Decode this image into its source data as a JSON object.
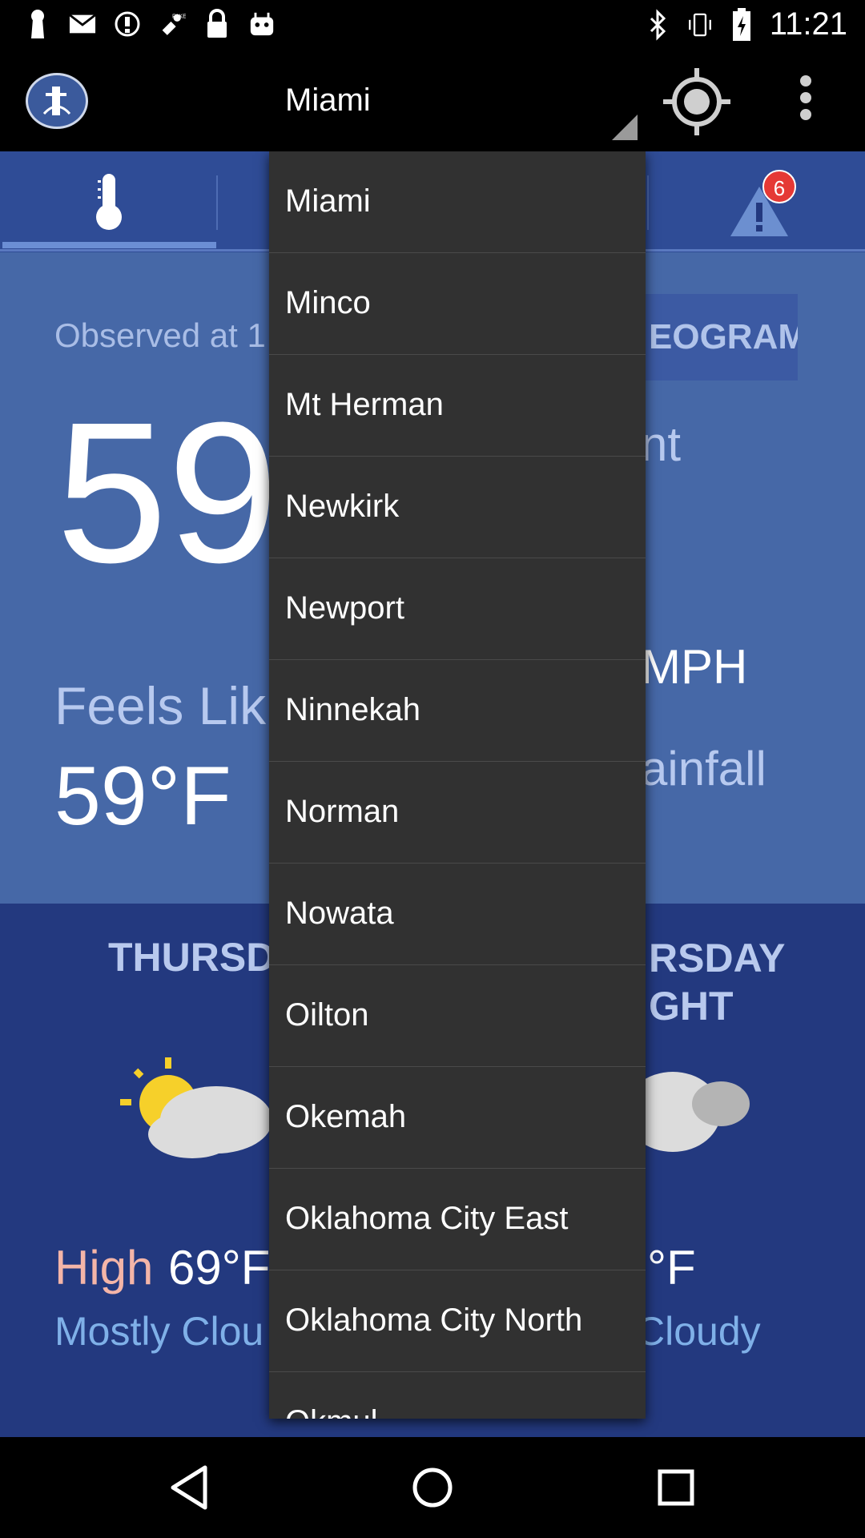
{
  "status_bar": {
    "time": "11:21",
    "left_icons": [
      "keyhole-icon",
      "mail-icon",
      "alert-circle-icon",
      "fake-gps-icon",
      "lock-icon",
      "android-icon"
    ],
    "right_icons": [
      "bluetooth-icon",
      "vibrate-icon",
      "battery-charging-icon"
    ]
  },
  "app_bar": {
    "location_selected": "Miami",
    "actions": [
      "locate-icon",
      "overflow-menu-icon"
    ]
  },
  "tabs": {
    "icons": [
      "thermometer-icon",
      "warning-icon"
    ],
    "alert_count": "6"
  },
  "current": {
    "observed_prefix": "Observed at 1",
    "temperature": "59",
    "feels_like_label": "Feels Lik",
    "feels_like_value": "59°F",
    "meteogram_button_partial": "EOGRAM",
    "right_partial_dew": "nt",
    "right_partial_wind": "MPH",
    "right_partial_rain": "ainfall"
  },
  "forecast": {
    "left_day_partial": "THURSD",
    "right_day_partial": [
      "RSDAY",
      "GHT"
    ],
    "high_label": "High",
    "high_value": "69°F",
    "left_condition_partial": "Mostly Clou",
    "right_value_partial": "°F",
    "right_condition_partial": "Cloudy"
  },
  "dropdown": {
    "items": [
      {
        "label": "Miami"
      },
      {
        "label": "Minco"
      },
      {
        "label": "Mt Herman"
      },
      {
        "label": "Newkirk"
      },
      {
        "label": "Newport"
      },
      {
        "label": "Ninnekah"
      },
      {
        "label": "Norman"
      },
      {
        "label": "Nowata"
      },
      {
        "label": "Oilton"
      },
      {
        "label": "Okemah"
      },
      {
        "label": "Oklahoma City East"
      },
      {
        "label": "Oklahoma City North"
      },
      {
        "label": "Okmul"
      }
    ]
  },
  "nav_bar": {
    "buttons": [
      "back-icon",
      "home-icon",
      "recents-icon"
    ]
  }
}
